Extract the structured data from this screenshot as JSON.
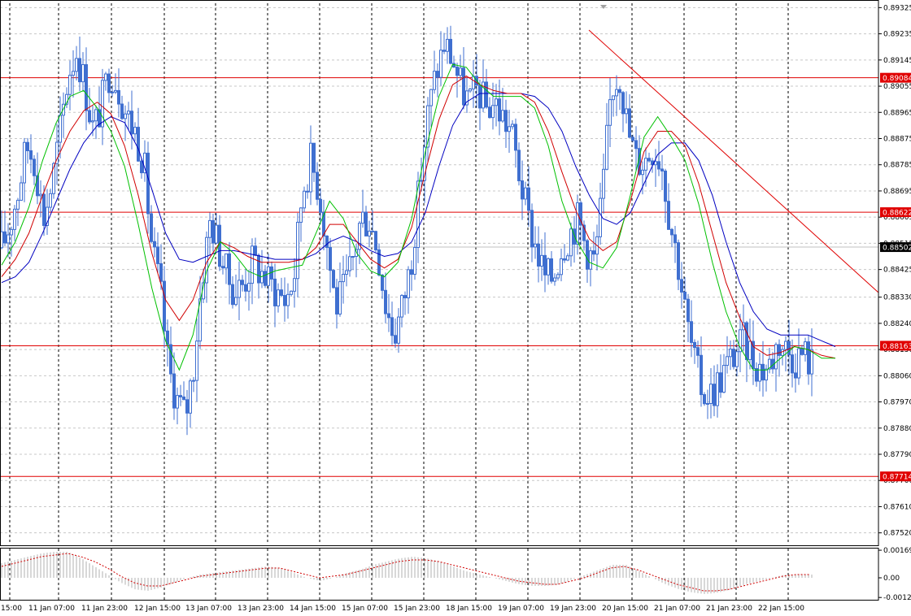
{
  "chart_data": {
    "type": "candlestick",
    "grid": true,
    "colors": {
      "candle": "#3f6fd0",
      "ma_fast": "#00c000",
      "ma_mid": "#d00000",
      "ma_slow": "#0000c0",
      "level": "#e00000",
      "trendline": "#e00000",
      "osc_hist": "#b0b0b0",
      "osc_signal": "#d00000"
    },
    "price_axis": {
      "ylim": [
        0.8748,
        0.8934
      ],
      "ticks": [
        "0.89325",
        "0.89235",
        "0.89145",
        "0.89055",
        "0.88965",
        "0.88875",
        "0.88785",
        "0.88695",
        "0.88605",
        "0.88515",
        "0.88425",
        "0.88330",
        "0.88240",
        "0.88150",
        "0.88060",
        "0.87970",
        "0.87880",
        "0.87790",
        "0.87700",
        "0.87610",
        "0.87520"
      ]
    },
    "x_labels": [
      "15:00",
      "11 Jan 07:00",
      "11 Jan 23:00",
      "12 Jan 15:00",
      "13 Jan 07:00",
      "13 Jan 23:00",
      "14 Jan 15:00",
      "15 Jan 07:00",
      "15 Jan 23:00",
      "18 Jan 15:00",
      "19 Jan 07:00",
      "19 Jan 23:00",
      "20 Jan 15:00",
      "21 Jan 07:00",
      "21 Jan 23:00",
      "22 Jan 15:00"
    ],
    "levels": [
      {
        "value": 0.89084,
        "label": "0.89084"
      },
      {
        "value": 0.88622,
        "label": "0.88622"
      },
      {
        "value": 0.88163,
        "label": "0.88163"
      },
      {
        "value": 0.87714,
        "label": "0.87714"
      }
    ],
    "current_price": {
      "value": 0.88502,
      "label": "0.88502"
    },
    "trendline": {
      "from": [
        0.0,
        0.8921
      ],
      "to": [
        1.0,
        0.88385
      ]
    },
    "price_path": [
      0.885,
      0.8858,
      0.887,
      0.8885,
      0.888,
      0.886,
      0.8872,
      0.889,
      0.891,
      0.8918,
      0.8905,
      0.889,
      0.89,
      0.8912,
      0.8905,
      0.8895,
      0.889,
      0.888,
      0.885,
      0.8835,
      0.8808,
      0.8798,
      0.8792,
      0.881,
      0.884,
      0.886,
      0.885,
      0.884,
      0.8835,
      0.8838,
      0.8845,
      0.8842,
      0.8838,
      0.8835,
      0.8832,
      0.884,
      0.887,
      0.888,
      0.887,
      0.885,
      0.883,
      0.8835,
      0.8845,
      0.886,
      0.886,
      0.885,
      0.883,
      0.882,
      0.883,
      0.8845,
      0.887,
      0.8895,
      0.891,
      0.892,
      0.8915,
      0.8905,
      0.89,
      0.8905,
      0.8898,
      0.89,
      0.8895,
      0.889,
      0.8875,
      0.886,
      0.885,
      0.884,
      0.884,
      0.885,
      0.8855,
      0.886,
      0.885,
      0.8845,
      0.887,
      0.8905,
      0.891,
      0.889,
      0.888,
      0.888,
      0.8885,
      0.888,
      0.886,
      0.8845,
      0.8825,
      0.881,
      0.88,
      0.88,
      0.8805,
      0.881,
      0.8815,
      0.8818,
      0.8812,
      0.8808,
      0.881,
      0.8818,
      0.8815,
      0.8812,
      0.8814,
      0.881
    ],
    "ma_fast": [
      0.8844,
      0.8852,
      0.8864,
      0.888,
      0.8893,
      0.8902,
      0.8904,
      0.8898,
      0.889,
      0.8878,
      0.8858,
      0.8836,
      0.8818,
      0.8808,
      0.882,
      0.8842,
      0.8852,
      0.8848,
      0.8842,
      0.884,
      0.8842,
      0.8843,
      0.8844,
      0.8855,
      0.8866,
      0.886,
      0.8848,
      0.8842,
      0.884,
      0.8845,
      0.886,
      0.8883,
      0.8902,
      0.8913,
      0.8912,
      0.8906,
      0.8902,
      0.8902,
      0.8902,
      0.8898,
      0.8885,
      0.8866,
      0.8853,
      0.8845,
      0.8843,
      0.885,
      0.8868,
      0.8888,
      0.8895,
      0.8888,
      0.888,
      0.8865,
      0.8845,
      0.8828,
      0.8816,
      0.8808,
      0.8808,
      0.8812,
      0.8816,
      0.8815,
      0.8812,
      0.8812
    ],
    "ma_mid": [
      0.884,
      0.8846,
      0.8855,
      0.8868,
      0.888,
      0.889,
      0.8897,
      0.89,
      0.8896,
      0.8885,
      0.8868,
      0.8848,
      0.8832,
      0.8825,
      0.8832,
      0.8845,
      0.8852,
      0.885,
      0.8847,
      0.8845,
      0.8845,
      0.8845,
      0.8846,
      0.885,
      0.8858,
      0.8858,
      0.8852,
      0.8846,
      0.8843,
      0.8846,
      0.8857,
      0.8876,
      0.8894,
      0.8906,
      0.8909,
      0.8906,
      0.8904,
      0.8903,
      0.8903,
      0.89,
      0.889,
      0.8876,
      0.8863,
      0.8853,
      0.8849,
      0.8852,
      0.8866,
      0.8883,
      0.889,
      0.889,
      0.8885,
      0.8872,
      0.8855,
      0.8838,
      0.8826,
      0.8816,
      0.8813,
      0.8814,
      0.8816,
      0.8815,
      0.8813,
      0.8812
    ],
    "ma_slow": [
      0.8838,
      0.884,
      0.8845,
      0.8855,
      0.8866,
      0.8877,
      0.8886,
      0.8892,
      0.8895,
      0.8893,
      0.8884,
      0.887,
      0.8855,
      0.8846,
      0.8845,
      0.8847,
      0.8849,
      0.8849,
      0.8848,
      0.8847,
      0.8846,
      0.8846,
      0.8846,
      0.8848,
      0.8852,
      0.8854,
      0.8852,
      0.8849,
      0.8847,
      0.8848,
      0.8852,
      0.8862,
      0.8878,
      0.8892,
      0.89,
      0.8903,
      0.8903,
      0.8903,
      0.8903,
      0.8902,
      0.8898,
      0.889,
      0.8878,
      0.8868,
      0.886,
      0.8858,
      0.8862,
      0.8872,
      0.8882,
      0.8886,
      0.8886,
      0.888,
      0.8868,
      0.8852,
      0.8838,
      0.8828,
      0.8822,
      0.882,
      0.882,
      0.882,
      0.8818,
      0.8816
    ],
    "oscillator": {
      "ticks": [
        "0.001697",
        "0.00",
        "-0.00121"
      ],
      "ylim": [
        -0.00135,
        0.0018
      ],
      "signal": [
        0.0007,
        0.0009,
        0.0011,
        0.0013,
        0.0014,
        0.0015,
        0.0013,
        0.001,
        0.0006,
        0.0001,
        -0.0003,
        -0.0005,
        -0.0005,
        -0.0003,
        -0.0001,
        0.0001,
        0.0002,
        0.0003,
        0.0004,
        0.0005,
        0.0006,
        0.0006,
        0.0004,
        0.0002,
        0.0,
        0.0001,
        0.0002,
        0.0004,
        0.0006,
        0.0008,
        0.001,
        0.0011,
        0.0011,
        0.001,
        0.0008,
        0.0006,
        0.0004,
        0.0002,
        0.0,
        -0.0002,
        -0.0003,
        -0.0004,
        -0.0004,
        -0.0002,
        0.0,
        0.0003,
        0.0006,
        0.0007,
        0.0005,
        0.0002,
        -0.0001,
        -0.0004,
        -0.0006,
        -0.0008,
        -0.0008,
        -0.0007,
        -0.0005,
        -0.0003,
        -0.0001,
        0.0001,
        0.0002,
        0.0002
      ],
      "histogram": [
        0.0009,
        0.0011,
        0.0013,
        0.0015,
        0.0016,
        0.0016,
        0.0012,
        0.0007,
        0.0002,
        -0.0003,
        -0.0007,
        -0.0008,
        -0.0006,
        -0.0003,
        0.0,
        0.0002,
        0.0003,
        0.0004,
        0.0005,
        0.0006,
        0.0007,
        0.0006,
        0.0003,
        0.0,
        -0.0002,
        0.0,
        0.0003,
        0.0005,
        0.0008,
        0.001,
        0.0012,
        0.0013,
        0.0012,
        0.001,
        0.0007,
        0.0004,
        0.0002,
        0.0,
        -0.0002,
        -0.0004,
        -0.0005,
        -0.0005,
        -0.0004,
        -0.0001,
        0.0002,
        0.0005,
        0.0008,
        0.0008,
        0.0004,
        0.0,
        -0.0004,
        -0.0007,
        -0.0009,
        -0.001,
        -0.0009,
        -0.0007,
        -0.0004,
        -0.0002,
        0.0,
        0.0002,
        0.0002,
        0.0002
      ]
    }
  }
}
